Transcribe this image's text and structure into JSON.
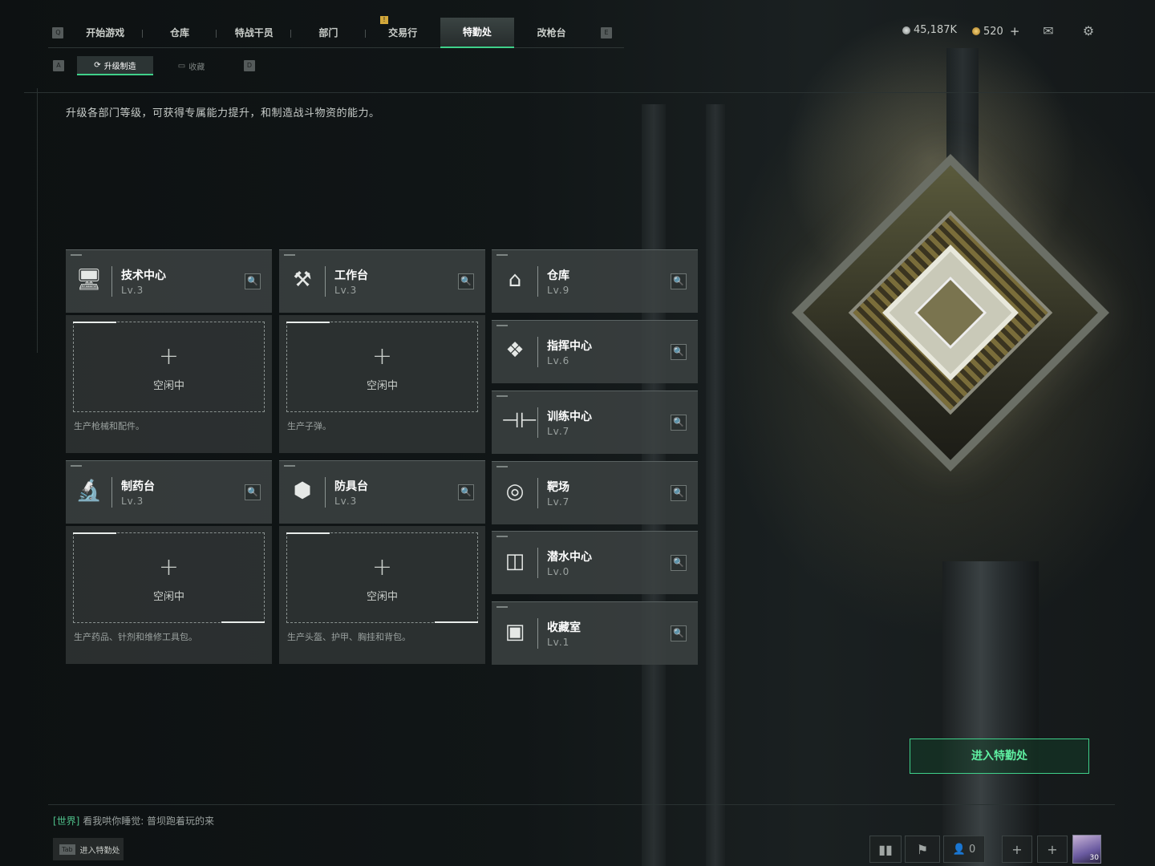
{
  "nav": {
    "left_key": "Q",
    "right_key": "E",
    "tabs": [
      {
        "label": "开始游戏"
      },
      {
        "label": "仓库"
      },
      {
        "label": "特战干员"
      },
      {
        "label": "部门"
      },
      {
        "label": "交易行"
      },
      {
        "label": "特勤处"
      },
      {
        "label": "改枪台"
      }
    ],
    "active_index": 5,
    "badge": "!"
  },
  "currency": {
    "silver": "45,187K",
    "gold": "520",
    "add_symbol": "+"
  },
  "subnav": {
    "left_key": "A",
    "right_key": "D",
    "tabs": [
      {
        "label": "升级制造"
      },
      {
        "label": "收藏"
      }
    ]
  },
  "description": "升级各部门等级，可获得专属能力提升，和制造战斗物资的能力。",
  "departments_main": [
    {
      "name": "技术中心",
      "level": "Lv.3",
      "icon": "computer-icon",
      "slot_label": "空闲中",
      "slot_plus": "+",
      "slot_desc": "生产枪械和配件。"
    },
    {
      "name": "工作台",
      "level": "Lv.3",
      "icon": "tools-icon",
      "slot_label": "空闲中",
      "slot_plus": "+",
      "slot_desc": "生产子弹。"
    },
    {
      "name": "制药台",
      "level": "Lv.3",
      "icon": "microscope-icon",
      "slot_label": "空闲中",
      "slot_plus": "+",
      "slot_desc": "生产药品、针剂和维修工具包。"
    },
    {
      "name": "防具台",
      "level": "Lv.3",
      "icon": "cubes-icon",
      "slot_label": "空闲中",
      "slot_plus": "+",
      "slot_desc": "生产头盔、护甲、胸挂和背包。"
    }
  ],
  "departments_side": [
    {
      "name": "仓库",
      "level": "Lv.9",
      "icon": "warehouse-icon"
    },
    {
      "name": "指挥中心",
      "level": "Lv.6",
      "icon": "chip-icon"
    },
    {
      "name": "训练中心",
      "level": "Lv.7",
      "icon": "dumbbell-icon"
    },
    {
      "name": "靶场",
      "level": "Lv.7",
      "icon": "target-icon"
    },
    {
      "name": "潜水中心",
      "level": "Lv.0",
      "icon": "goggles-icon"
    },
    {
      "name": "收藏室",
      "level": "Lv.1",
      "icon": "display-case-icon"
    }
  ],
  "enter_button": "进入特勤处",
  "chat": {
    "channel": "[世界]",
    "message": "看我哄你睡觉: 普坝跑着玩的来"
  },
  "tab_hint": {
    "key": "Tab",
    "label": "进入特勤处"
  },
  "dock": {
    "friends_count": "0",
    "avatar_level": "30"
  },
  "colors": {
    "accent": "#3fd08a",
    "card_bg": "#3c4242",
    "badge": "#d3a83a"
  }
}
